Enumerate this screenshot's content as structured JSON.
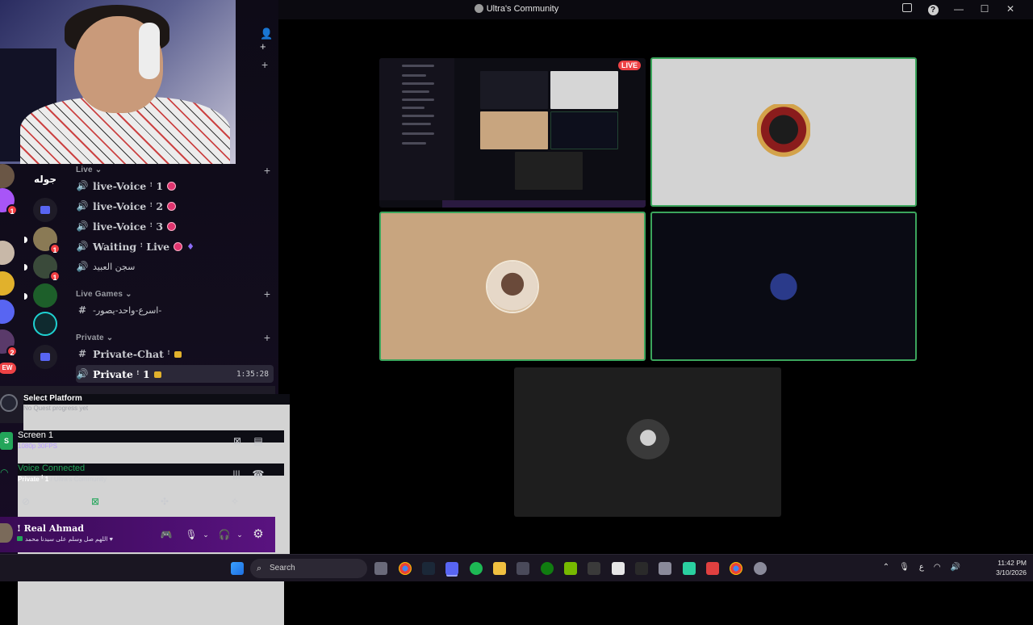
{
  "window": {
    "title": "Ultra's Community"
  },
  "sidebar": {
    "categories": [
      {
        "label": "Live"
      },
      {
        "label": "Live Games"
      },
      {
        "label": "Private"
      }
    ],
    "channels": [
      {
        "name": "live-Voice ꜝ 1"
      },
      {
        "name": "live-Voice ꜝ 2"
      },
      {
        "name": "live-Voice ꜝ 3"
      },
      {
        "name": "Waiting ꜝ Live"
      },
      {
        "name": "سجن العبيد"
      },
      {
        "name": "-اسرع-واحد-يصور-"
      },
      {
        "name": "Private-Chat ꜝ"
      },
      {
        "name": "Private ꜝ 1",
        "timer": "1:35:28"
      }
    ],
    "server_label": "جوله",
    "badges": [
      "1",
      "1",
      "1",
      "2"
    ],
    "new_badge": "EW"
  },
  "quest": {
    "title": "Select Platform",
    "subtitle": "No Quest progress yet"
  },
  "stream": {
    "title": "Screen 1",
    "quality": "1080p 30FPS"
  },
  "voice": {
    "status": "Voice Connected",
    "channel": "Private ꜝ 1",
    "server": "/ Ultra's Community"
  },
  "user": {
    "name": "! Real Ahmad",
    "status": "اللهم صل وسلم على سيدنا محمد ♥"
  },
  "stage": {
    "live_label": "LIVE"
  },
  "taskbar": {
    "search_placeholder": "Search",
    "time": "11:42 PM",
    "date": "3/10/2026",
    "lang": "ع"
  }
}
